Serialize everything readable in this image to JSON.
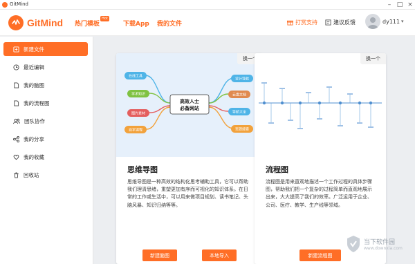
{
  "window": {
    "title": "GitMind",
    "minimize": "–",
    "maximize": "□",
    "close": "×"
  },
  "header": {
    "brand": "GitMind",
    "nav": [
      {
        "label": "热门模板",
        "badge": "Hot"
      },
      {
        "label": "下载App"
      },
      {
        "label": "我的文件"
      }
    ],
    "support": "打赏支持",
    "feedback": "建议反馈",
    "username": "dy111",
    "caret": "▾"
  },
  "sidebar": {
    "items": [
      {
        "label": "新建文件",
        "icon": "new-file-icon"
      },
      {
        "label": "最近编辑",
        "icon": "clock-icon"
      },
      {
        "label": "我的脑图",
        "icon": "file-icon"
      },
      {
        "label": "我的流程图",
        "icon": "file-icon"
      },
      {
        "label": "团队协作",
        "icon": "team-icon"
      },
      {
        "label": "我的分享",
        "icon": "share-icon"
      },
      {
        "label": "我的收藏",
        "icon": "heart-icon"
      },
      {
        "label": "回收站",
        "icon": "trash-icon"
      }
    ]
  },
  "cards": {
    "mindmap": {
      "swap": "换一个",
      "title": "思维导图",
      "desc": "思维导图是一种高效的结构化思考辅助工具，它可以帮助我们理清思绪，重塑更加有序而可视化的知识体系。在日常的工作或生活中，可以用来做项目规划、读书笔记、头脑风暴、知识归纳等等。",
      "btn_new": "新建脑图",
      "btn_import": "本地导入",
      "center": [
        "高效人士",
        "必备网站"
      ],
      "left_nodes": [
        "在线工具",
        "学术知识",
        "图片素材",
        "自学课程"
      ],
      "right_nodes": [
        "设计导航",
        "云盘文档",
        "导航大全",
        "资源搜索"
      ],
      "colors": [
        "#4fb4e7",
        "#7fc241",
        "#e45e5e",
        "#f2a23c"
      ]
    },
    "flowchart": {
      "swap": "换一个",
      "title": "流程图",
      "desc": "流程图是用来直观地描述一个工作过程的具体步骤图，帮助我们把一个复杂的过程简单而直观地展示出来，大大提高了我们的效率。广泛运用于企业、公司、医疗、教学、生产线等领域。",
      "btn_new": "新建流程图"
    }
  },
  "watermark": {
    "line1": "当下软件园",
    "line2": "www.downxia.com"
  }
}
